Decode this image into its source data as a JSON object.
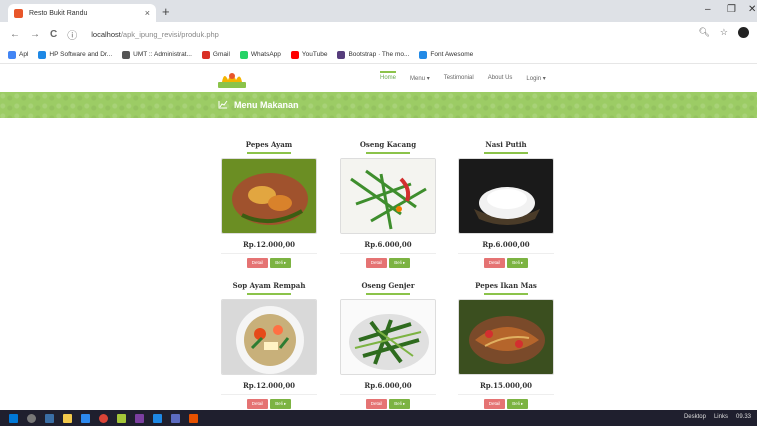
{
  "browser": {
    "tab_title": "Resto Bukit Randu",
    "tab_close": "×",
    "new_tab": "+",
    "url_host": "localhost",
    "url_path": "/apk_ipung_revisi/produk.php",
    "nav": {
      "back": "←",
      "forward": "→",
      "reload": "C",
      "info": "ⓘ"
    },
    "window_controls": {
      "minimize": "–",
      "maximize": "❐",
      "close": "✕"
    },
    "bookmarks": [
      {
        "label": "Apl",
        "color": "#4285f4"
      },
      {
        "label": "HP Software and Dr...",
        "color": "#1e88e5"
      },
      {
        "label": "UMT :: Administrat...",
        "color": "#555555"
      },
      {
        "label": "Gmail",
        "color": "#d93025"
      },
      {
        "label": "WhatsApp",
        "color": "#25d366"
      },
      {
        "label": "YouTube",
        "color": "#ff0000"
      },
      {
        "label": "Bootstrap · The mo...",
        "color": "#563d7c"
      },
      {
        "label": "Font Awesome",
        "color": "#228ae6"
      }
    ]
  },
  "site": {
    "menu": [
      {
        "label": "Home",
        "active": true
      },
      {
        "label": "Menu ▾",
        "active": false
      },
      {
        "label": "Testimonial",
        "active": false
      },
      {
        "label": "About Us",
        "active": false
      },
      {
        "label": "Login ▾",
        "active": false
      }
    ],
    "banner_title": "Menu Makanan",
    "detail_label": "Detail",
    "beli_label": "Beli ▸",
    "products": [
      {
        "name": "Pepes Ayam",
        "price": "Rp.12.000,00"
      },
      {
        "name": "Oseng Kacang",
        "price": "Rp.6.000,00"
      },
      {
        "name": "Nasi Putih",
        "price": "Rp.6.000,00"
      },
      {
        "name": "Sop Ayam Rempah",
        "price": "Rp.12.000,00"
      },
      {
        "name": "Oseng Genjer",
        "price": "Rp.6.000,00"
      },
      {
        "name": "Pepes Ikan Mas",
        "price": "Rp.15.000,00"
      }
    ]
  },
  "taskbar": {
    "desktop": "Desktop",
    "links": "Links",
    "time": "09.33"
  },
  "colors": {
    "accent_green": "#9ccc65",
    "detail_red": "#e57373",
    "beli_green": "#7cb342"
  }
}
